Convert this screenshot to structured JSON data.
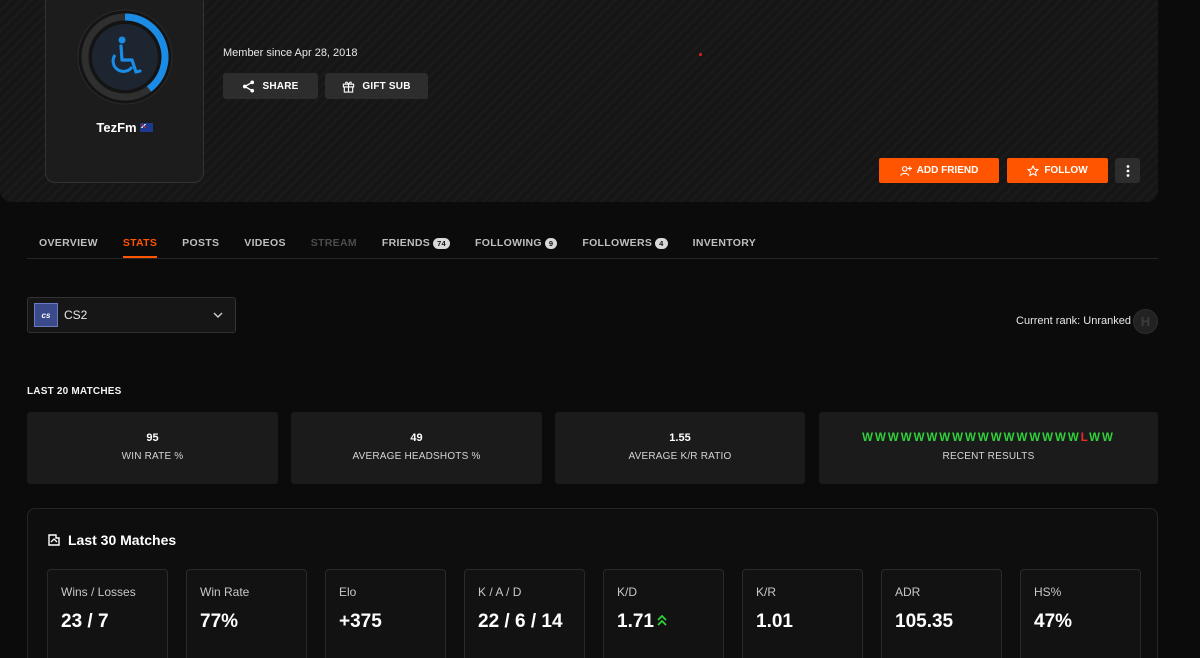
{
  "profile": {
    "username": "TezFm",
    "member_since": "Member since Apr 28, 2018",
    "share_label": "SHARE",
    "gift_label": "GIFT SUB",
    "add_friend_label": "ADD FRIEND",
    "follow_label": "FOLLOW"
  },
  "tabs": [
    {
      "label": "OVERVIEW",
      "count": null,
      "state": "normal"
    },
    {
      "label": "STATS",
      "count": null,
      "state": "active"
    },
    {
      "label": "POSTS",
      "count": null,
      "state": "normal"
    },
    {
      "label": "VIDEOS",
      "count": null,
      "state": "normal"
    },
    {
      "label": "STREAM",
      "count": null,
      "state": "disabled"
    },
    {
      "label": "FRIENDS",
      "count": "74",
      "state": "normal"
    },
    {
      "label": "FOLLOWING",
      "count": "9",
      "state": "normal"
    },
    {
      "label": "FOLLOWERS",
      "count": "4",
      "state": "normal"
    },
    {
      "label": "INVENTORY",
      "count": null,
      "state": "normal"
    }
  ],
  "game_select": {
    "logo_text": "cs",
    "value": "CS2"
  },
  "rank": {
    "label": "Current rank: Unranked",
    "badge_letter": "H"
  },
  "last20": {
    "title": "LAST 20 MATCHES",
    "win_rate": {
      "value": "95",
      "label": "WIN RATE %"
    },
    "headshots": {
      "value": "49",
      "label": "AVERAGE HEADSHOTS %"
    },
    "kr_ratio": {
      "value": "1.55",
      "label": "AVERAGE K/R RATIO"
    },
    "recent": {
      "results": [
        "W",
        "W",
        "W",
        "W",
        "W",
        "W",
        "W",
        "W",
        "W",
        "W",
        "W",
        "W",
        "W",
        "W",
        "W",
        "W",
        "W",
        "L",
        "W",
        "W"
      ],
      "label": "RECENT RESULTS"
    }
  },
  "last30": {
    "title": "Last 30 Matches",
    "cards": [
      {
        "label": "Wins / Losses",
        "value": "23 / 7",
        "trend": null
      },
      {
        "label": "Win Rate",
        "value": "77%",
        "trend": null
      },
      {
        "label": "Elo",
        "value": "+375",
        "trend": null
      },
      {
        "label": "K / A / D",
        "value": "22 / 6 / 14",
        "trend": null
      },
      {
        "label": "K/D",
        "value": "1.71",
        "trend": "up"
      },
      {
        "label": "K/R",
        "value": "1.01",
        "trend": null
      },
      {
        "label": "ADR",
        "value": "105.35",
        "trend": null
      },
      {
        "label": "HS%",
        "value": "47%",
        "trend": null
      }
    ]
  },
  "colors": {
    "accent": "#ff5500",
    "win": "#2fd23a",
    "loss": "#ee2a2a",
    "avatar_ring": "#1a8ce6",
    "trend_up": "#2fd23a"
  },
  "icons": {
    "avatar": "wheelchair-icon",
    "share": "share-icon",
    "gift": "gift-icon",
    "add_friend": "user-plus-icon",
    "follow": "star-icon",
    "more": "more-vertical-icon",
    "dropdown": "chevron-down-icon",
    "matches": "faceit-icon",
    "trend": "double-chevron-up-icon"
  }
}
